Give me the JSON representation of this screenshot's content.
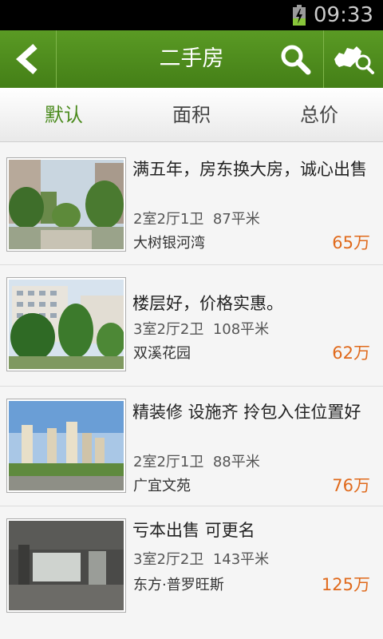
{
  "status_bar": {
    "time": "09:33",
    "battery_icon": "battery-charging-icon"
  },
  "title_bar": {
    "title": "二手房",
    "back_icon": "back-arrow-icon",
    "search_icon": "search-icon",
    "map_search_icon": "map-search-icon"
  },
  "tabs": [
    {
      "label": "默认",
      "active": true
    },
    {
      "label": "面积",
      "active": false
    },
    {
      "label": "总价",
      "active": false
    }
  ],
  "colors": {
    "brand_green": "#4a8a1c",
    "price_orange": "#e06a1c"
  },
  "listings": [
    {
      "name": "满五年，房东换大房，诚心出售",
      "rooms": "2室2厅1卫",
      "area": "87平米",
      "estate": "大树银河湾",
      "price": "65万"
    },
    {
      "name": "楼层好，价格实惠。",
      "rooms": "3室2厅2卫",
      "area": "108平米",
      "estate": "双溪花园",
      "price": "62万"
    },
    {
      "name": "精装修  设施齐  拎包入住位置好",
      "rooms": "2室2厅1卫",
      "area": "88平米",
      "estate": "广宜文苑",
      "price": "76万"
    },
    {
      "name": "亏本出售 可更名",
      "rooms": "3室2厅2卫",
      "area": "143平米",
      "estate": "东方·普罗旺斯",
      "price": "125万"
    }
  ]
}
